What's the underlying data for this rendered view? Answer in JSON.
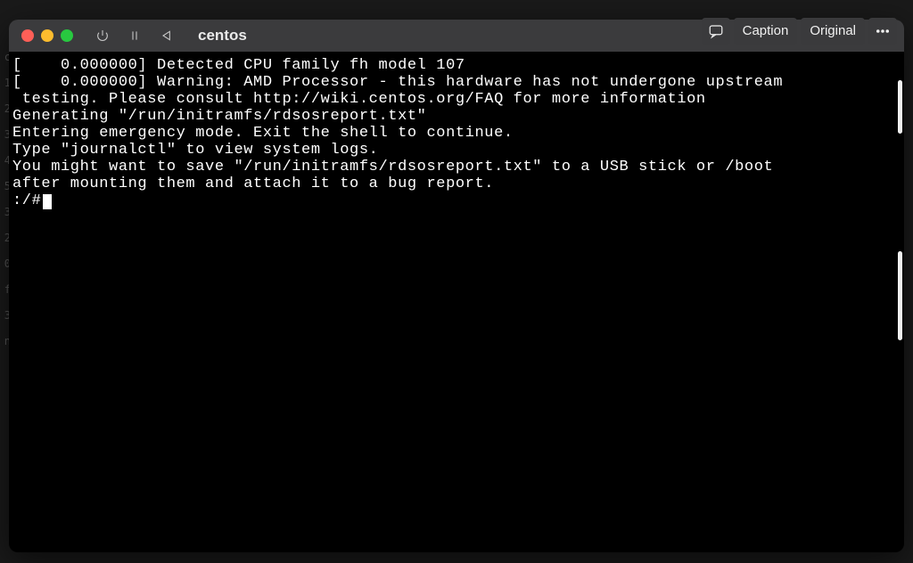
{
  "overlay": {
    "caption_label": "Caption",
    "original_label": "Original"
  },
  "window": {
    "title": "centos"
  },
  "gutter_hints": [
    "c",
    "1",
    "2",
    "3",
    "4",
    "5",
    "3",
    "2",
    "0",
    "f",
    "3",
    "n",
    " ",
    " ",
    " ",
    " "
  ],
  "console": {
    "lines": [
      "[    0.000000] Detected CPU family fh model 107",
      "[    0.000000] Warning: AMD Processor - this hardware has not undergone upstream",
      " testing. Please consult http://wiki.centos.org/FAQ for more information",
      "",
      "Generating \"/run/initramfs/rdsosreport.txt\"",
      "",
      "",
      "Entering emergency mode. Exit the shell to continue.",
      "Type \"journalctl\" to view system logs.",
      "You might want to save \"/run/initramfs/rdsosreport.txt\" to a USB stick or /boot",
      "after mounting them and attach it to a bug report.",
      "",
      "",
      ":/#"
    ]
  }
}
